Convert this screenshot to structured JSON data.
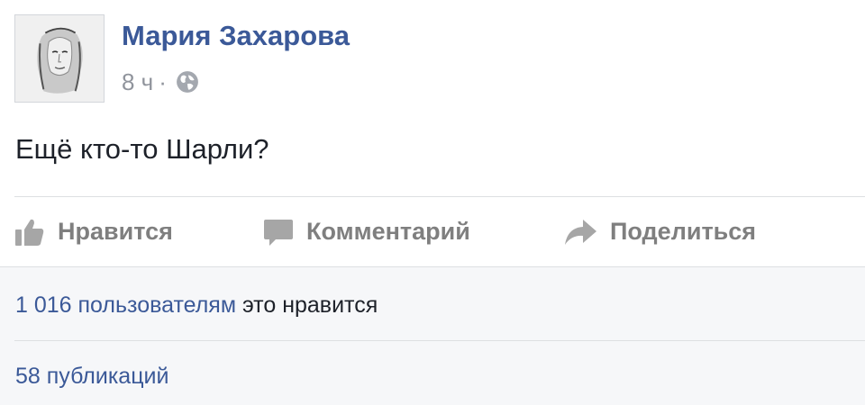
{
  "post": {
    "author": "Мария Захарова",
    "time": "8 ч",
    "separator": "·",
    "audience_icon": "globe-icon",
    "text": "Ещё кто-то Шарли?"
  },
  "actions": {
    "like": {
      "label": "Нравится",
      "icon": "thumbs-up-icon"
    },
    "comment": {
      "label": "Комментарий",
      "icon": "comment-icon"
    },
    "share": {
      "label": "Поделиться",
      "icon": "share-arrow-icon"
    }
  },
  "stats": {
    "likes_count": "1 016 пользователям",
    "likes_suffix": " это нравится",
    "shares": "58 публикаций"
  },
  "colors": {
    "link": "#3b5998",
    "text": "#1d2129",
    "muted": "#90949c",
    "action": "#7f7f7f",
    "section_bg": "#f6f7f9"
  }
}
